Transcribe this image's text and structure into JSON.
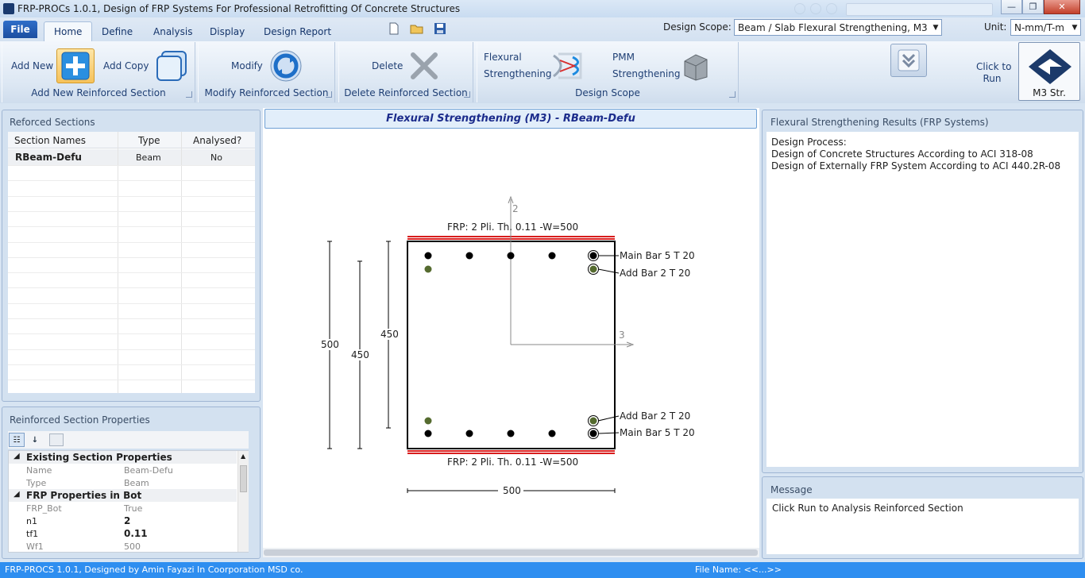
{
  "window": {
    "title": "FRP-PROCs 1.0.1,  Design of FRP Systems For Professional Retrofitting Of Concrete Structures",
    "minimize": "—",
    "maximize": "❐",
    "close": "✕"
  },
  "tabs": {
    "file": "File",
    "home": "Home",
    "define": "Define",
    "analysis": "Analysis",
    "display": "Display",
    "design_report": "Design Report"
  },
  "scope": {
    "label": "Design Scope:",
    "value": "Beam / Slab Flexural Strengthening, M3"
  },
  "unit": {
    "label": "Unit:",
    "value": "N-mm/T-m"
  },
  "ribbon": {
    "add_new": "Add New",
    "add_copy": "Add Copy",
    "group_add": "Add New Reinforced Section",
    "modify": "Modify",
    "group_modify": "Modify Reinforced Section",
    "delete": "Delete",
    "group_delete": "Delete Reinforced Section",
    "flexural_line1": "Flexural",
    "flexural_line2": "Strengthening",
    "pmm_line1": "PMM",
    "pmm_line2": "Strengthening",
    "group_scope": "Design Scope",
    "click_to_line1": "Click to",
    "click_to_line2": "Run",
    "run_button": "M3 Str."
  },
  "sections": {
    "title": "Reforced Sections",
    "headers": [
      "Section Names",
      "Type",
      "Analysed?"
    ],
    "rows": [
      {
        "name": "RBeam-Defu",
        "type": "Beam",
        "analysed": "No"
      }
    ]
  },
  "properties": {
    "title": "Reinforced Section Properties",
    "cat1": "Existing Section Properties",
    "name_label": "Name",
    "name_value": "Beam-Defu",
    "type_label": "Type",
    "type_value": "Beam",
    "cat2": "FRP Properties in Bot",
    "frp_label": "FRP_Bot",
    "frp_value": "True",
    "n1_label": "n1",
    "n1_value": "2",
    "tf1_label": "tf1",
    "tf1_value": "0.11",
    "wf1_label": "Wf1",
    "wf1_value": "500"
  },
  "drawing": {
    "header": "Flexural Strengthening (M3) - RBeam-Defu",
    "frp_top": "FRP: 2 Pli. Th. 0.11 -W=500",
    "frp_bot": "FRP: 2 Pli. Th. 0.11 -W=500",
    "main_bar_top": "Main Bar 5 T 20",
    "add_bar_top": "Add Bar 2 T 20",
    "add_bar_bot": "Add Bar 2 T 20",
    "main_bar_bot": "Main Bar 5 T 20",
    "dim_500_v": "500",
    "dim_450_a": "450",
    "dim_450_b": "450",
    "dim_500_h": "500",
    "axis_2": "2",
    "axis_3": "3"
  },
  "results": {
    "title": "Flexural Strengthening Results (FRP Systems)",
    "line1": "Design Process:",
    "line2": "Design of Concrete Structures According to ACI 318-08",
    "line3": "Design of Externally FRP System According to ACI 440.2R-08"
  },
  "message": {
    "title": "Message",
    "text": "Click Run to Analysis Reinforced Section"
  },
  "status": {
    "left": "FRP-PROCS 1.0.1, Designed by Amin Fayazi In Coorporation MSD co.",
    "file": "File Name: <<...>>"
  },
  "colors": {
    "frp": "#d81e1e",
    "accent": "#2e8ef0",
    "add_bar": "#556b2f"
  }
}
